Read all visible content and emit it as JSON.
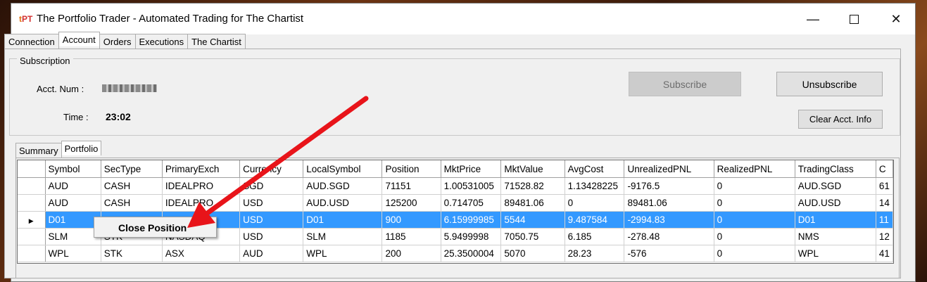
{
  "window": {
    "logo_t": "t",
    "logo_pt": "PT",
    "title": "The Portfolio Trader - Automated Trading for The Chartist",
    "minimize_glyph": "—",
    "close_glyph": "✕"
  },
  "main_tabs": [
    "Connection",
    "Account",
    "Orders",
    "Executions",
    "The Chartist"
  ],
  "subscription": {
    "group_title": "Subscription",
    "acct_label": "Acct. Num :",
    "time_label": "Time :",
    "time_value": "23:02",
    "subscribe_label": "Subscribe",
    "unsubscribe_label": "Unsubscribe",
    "clear_label": "Clear Acct. Info"
  },
  "sub_tabs": [
    "Summary",
    "Portfolio"
  ],
  "portfolio": {
    "columns": [
      "Symbol",
      "SecType",
      "PrimaryExch",
      "Currency",
      "LocalSymbol",
      "Position",
      "MktPrice",
      "MktValue",
      "AvgCost",
      "UnrealizedPNL",
      "RealizedPNL",
      "TradingClass",
      "C"
    ],
    "rows": [
      [
        "AUD",
        "CASH",
        "IDEALPRO",
        "SGD",
        "AUD.SGD",
        "71151",
        "1.00531005",
        "71528.82",
        "1.13428225",
        "-9176.5",
        "0",
        "AUD.SGD",
        "61"
      ],
      [
        "AUD",
        "CASH",
        "IDEALPRO",
        "USD",
        "AUD.USD",
        "125200",
        "0.714705",
        "89481.06",
        "0",
        "89481.06",
        "0",
        "AUD.USD",
        "14"
      ],
      [
        "D01",
        "",
        "",
        "USD",
        "D01",
        "900",
        "6.15999985",
        "5544",
        "9.487584",
        "-2994.83",
        "0",
        "D01",
        "11"
      ],
      [
        "SLM",
        "STK",
        "NASDAQ",
        "USD",
        "SLM",
        "1185",
        "5.9499998",
        "7050.75",
        "6.185",
        "-278.48",
        "0",
        "NMS",
        "12"
      ],
      [
        "WPL",
        "STK",
        "ASX",
        "AUD",
        "WPL",
        "200",
        "25.3500004",
        "5070",
        "28.23",
        "-576",
        "0",
        "WPL",
        "41"
      ]
    ],
    "selected_row_marker": "▶"
  },
  "context_menu": {
    "item": "Close Position"
  },
  "colors": {
    "selection": "#3399ff",
    "arrow": "#e8141a",
    "logo": "#e07010"
  }
}
